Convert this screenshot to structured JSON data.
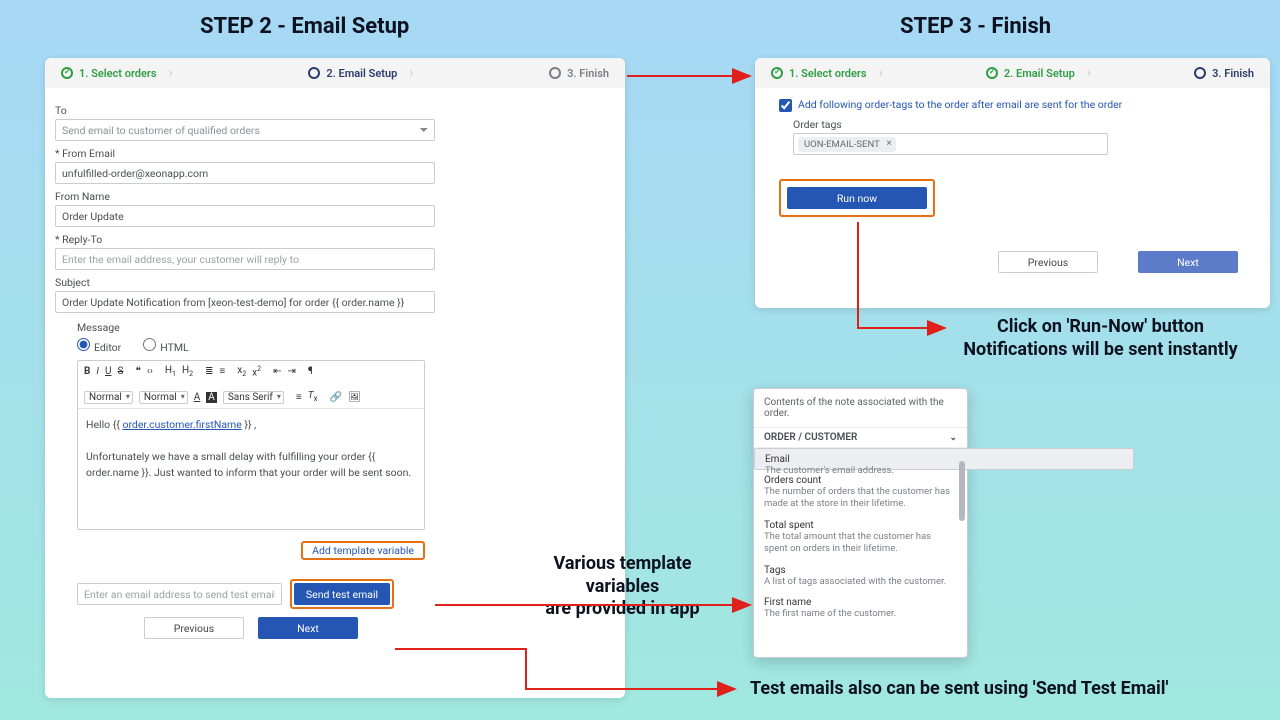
{
  "titles": {
    "step2": "STEP 2 - Email Setup",
    "step3": "STEP 3 - Finish"
  },
  "stepper": {
    "s1": "1. Select orders",
    "s2": "2. Email Setup",
    "s3": "3. Finish"
  },
  "left": {
    "to_label": "To",
    "to_value": "Send email to customer of qualified orders",
    "from_email_label": "* From Email",
    "from_email_value": "unfulfilled-order@xeonapp.com",
    "from_name_label": "From Name",
    "from_name_value": "Order Update",
    "reply_to_label": "* Reply-To",
    "reply_to_placeholder": "Enter the email address, your customer will reply to",
    "subject_label": "Subject",
    "subject_value": "Order Update Notification from [xeon-test-demo] for order {{ order.name }}",
    "message_label": "Message",
    "radio_editor": "Editor",
    "radio_html": "HTML",
    "fontsel1": "Normal",
    "fontsel2": "Normal",
    "fontsel3": "Sans Serif",
    "body_greeting_pre": "Hello {{ ",
    "body_greeting_var": "order.customer.firstName",
    "body_greeting_post": " }} ,",
    "body_para": "Unfortunately we have a small delay with fulfilling your order {{ order.name }}. Just wanted to inform that your order will be sent soon.",
    "add_var_link": "Add template variable",
    "test_placeholder": "Enter an email address to send test email.",
    "send_test_btn": "Send test email",
    "prev_btn": "Previous",
    "next_btn": "Next"
  },
  "right": {
    "add_tags_check": "Add following order-tags to the order after email are sent for the order",
    "order_tags_label": "Order tags",
    "tag_value": "UON-EMAIL-SENT",
    "run_now_btn": "Run now",
    "prev_btn": "Previous",
    "next_btn": "Next"
  },
  "popup": {
    "head": "Contents of the note associated with the order.",
    "cat": "ORDER / CUSTOMER",
    "items": [
      {
        "title": "Email",
        "desc": "The customer's email address."
      },
      {
        "title": "Orders count",
        "desc": "The number of orders that the customer has made at the store in their lifetime."
      },
      {
        "title": "Total spent",
        "desc": "The total amount that the customer has spent on orders in their lifetime."
      },
      {
        "title": "Tags",
        "desc": "A list of tags associated with the customer."
      },
      {
        "title": "First name",
        "desc": "The first name of the customer."
      }
    ]
  },
  "annot": {
    "vars1": "Various template variables",
    "vars2": "are provided in app",
    "run1": "Click on 'Run-Now' button",
    "run2": "Notifications will be sent instantly",
    "test": "Test emails also can be sent using 'Send Test Email'"
  }
}
